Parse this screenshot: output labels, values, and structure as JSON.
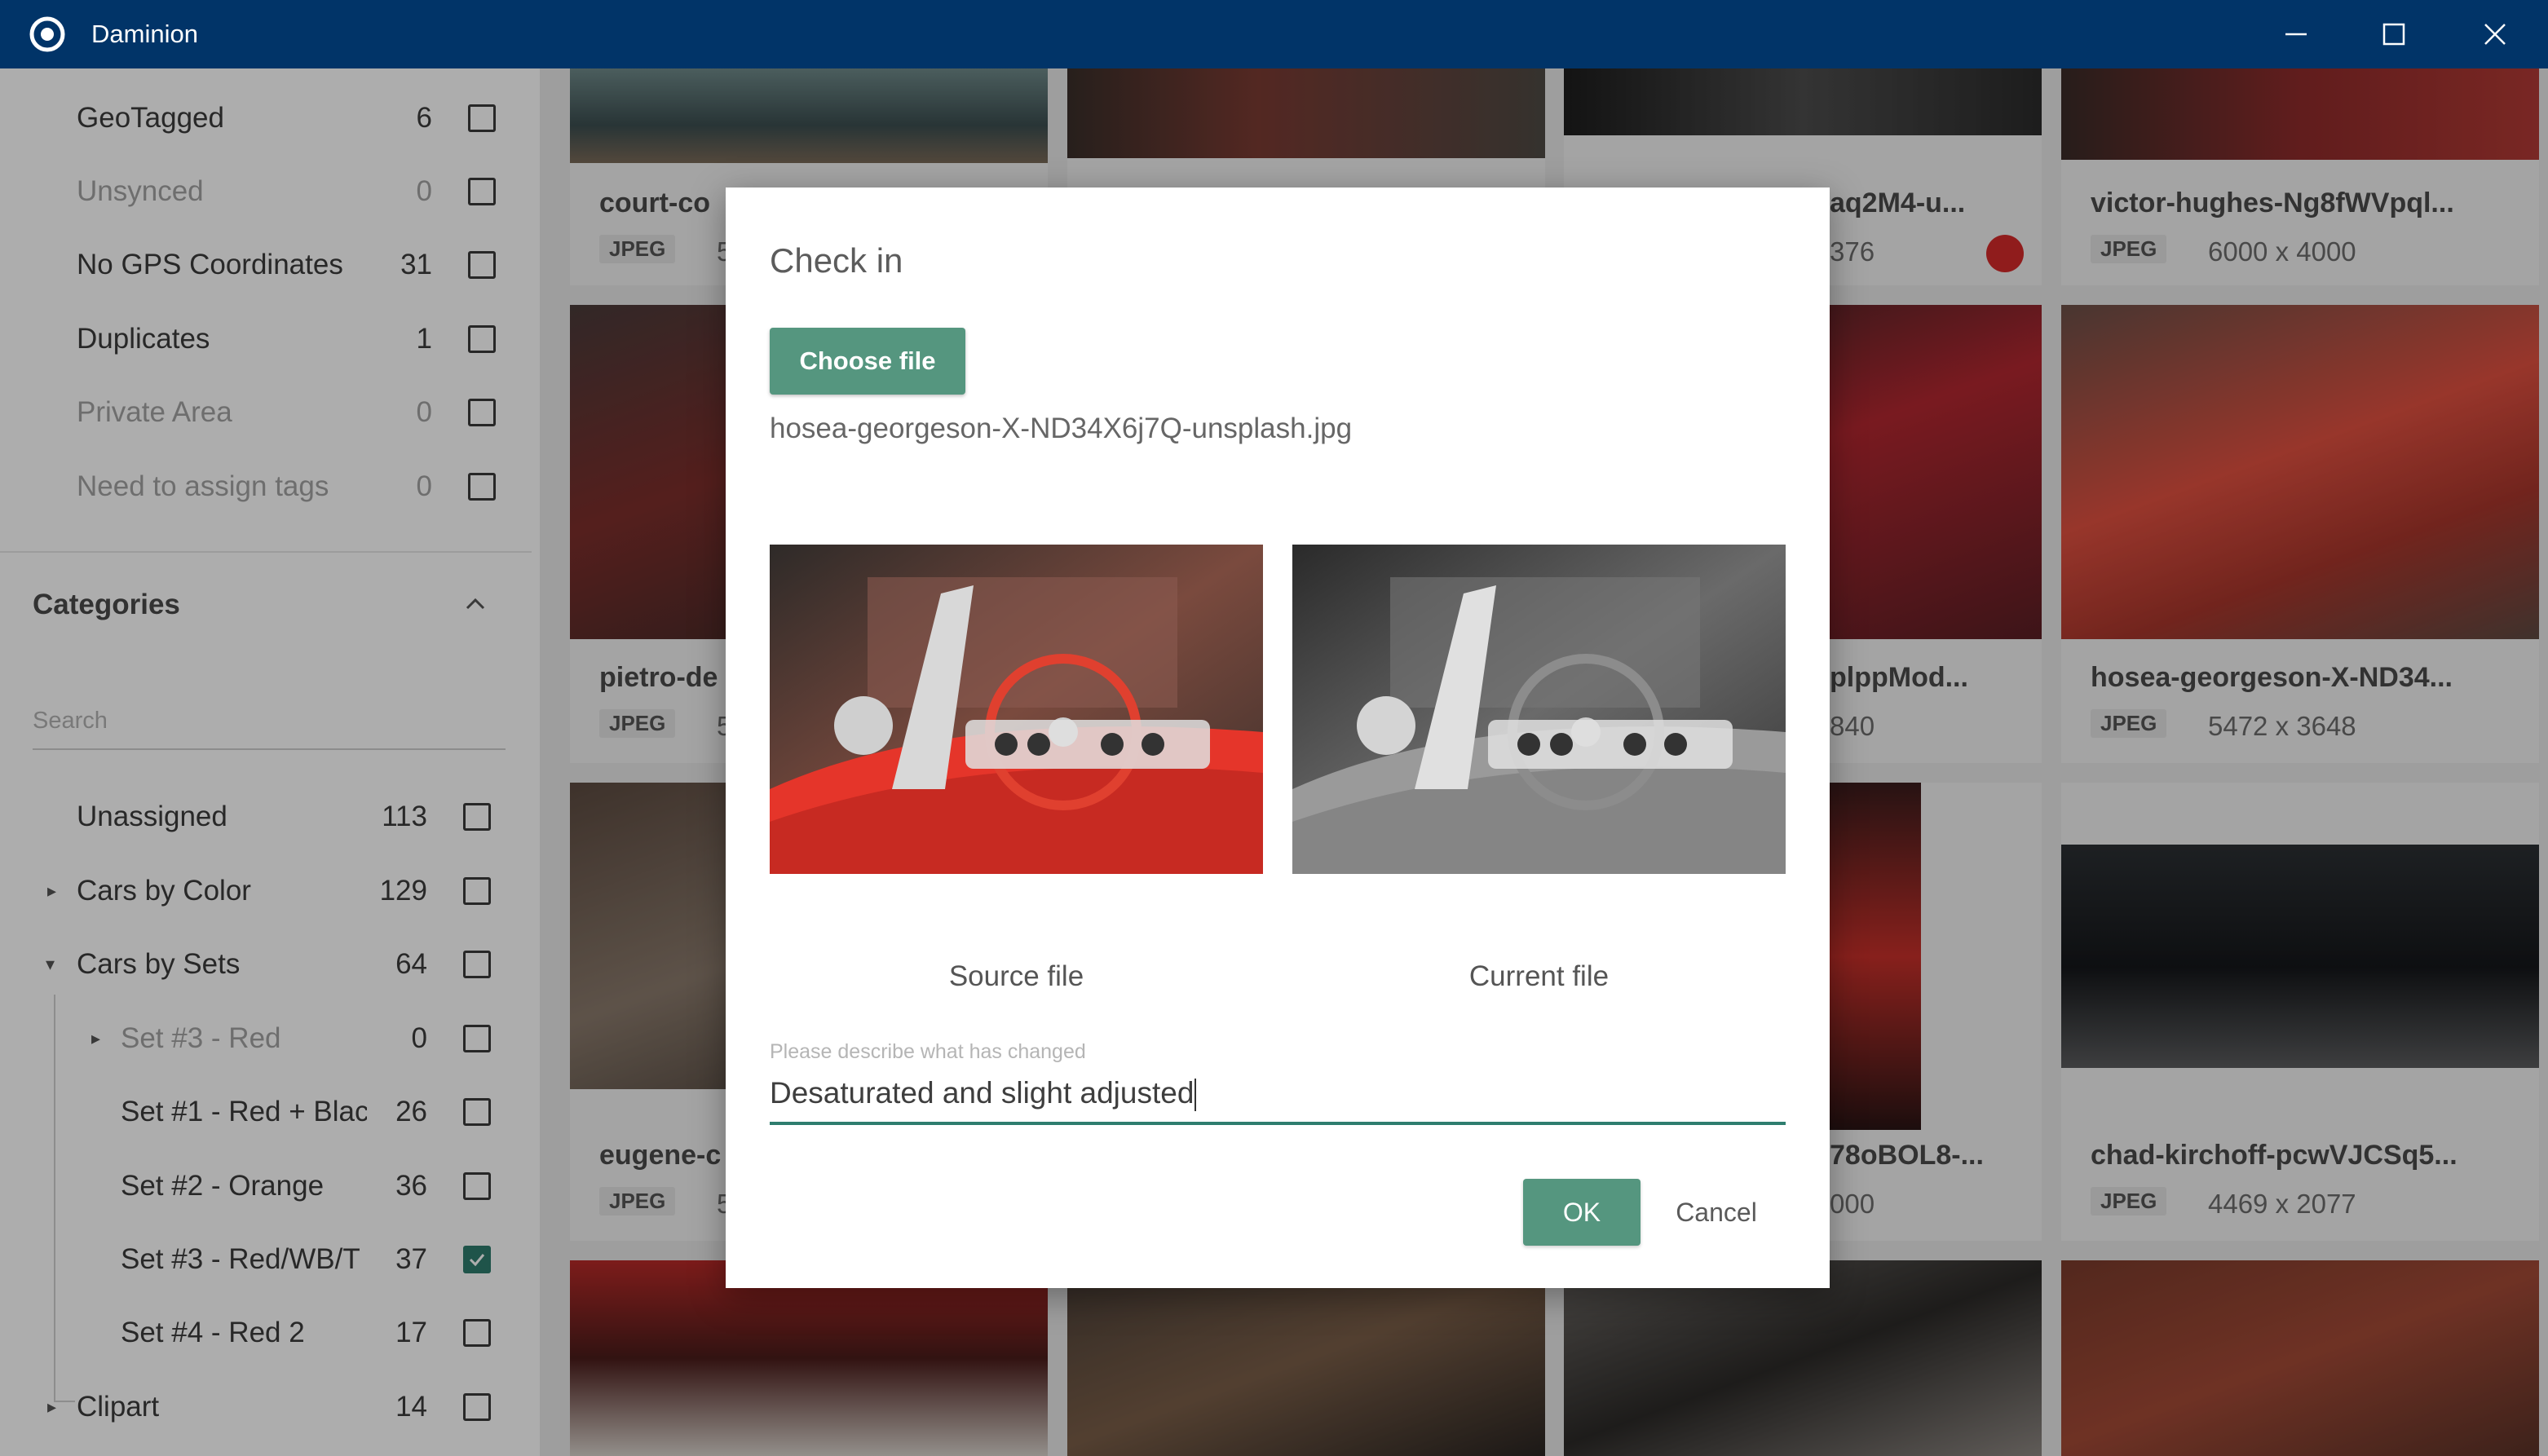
{
  "window": {
    "title": "Daminion"
  },
  "filters": [
    {
      "label": "GeoTagged",
      "count": "6",
      "dim": false
    },
    {
      "label": "Unsynced",
      "count": "0",
      "dim": true
    },
    {
      "label": "No GPS Coordinates",
      "count": "31",
      "dim": false
    },
    {
      "label": "Duplicates",
      "count": "1",
      "dim": false
    },
    {
      "label": "Private Area",
      "count": "0",
      "dim": true
    },
    {
      "label": "Need to assign tags",
      "count": "0",
      "dim": true
    }
  ],
  "categories": {
    "title": "Categories",
    "search_placeholder": "Search",
    "items": [
      {
        "label": "Unassigned",
        "count": "113",
        "checked": false
      },
      {
        "label": "Cars by Color",
        "count": "129",
        "checked": false
      },
      {
        "label": "Cars by Sets",
        "count": "64",
        "checked": false
      },
      {
        "label": "Set #3 - Red",
        "count": "0",
        "checked": false
      },
      {
        "label": "Set #1 - Red + Black",
        "count": "26",
        "checked": false
      },
      {
        "label": "Set #2 - Orange",
        "count": "36",
        "checked": false
      },
      {
        "label": "Set #3 - Red/WB/T",
        "count": "37",
        "checked": true
      },
      {
        "label": "Set #4 - Red 2",
        "count": "17",
        "checked": false
      },
      {
        "label": "Clipart",
        "count": "14",
        "checked": false
      }
    ]
  },
  "grid": {
    "tiles": [
      {
        "name": "court-co",
        "badge": "JPEG",
        "dims": "5"
      },
      {
        "name": "",
        "badge": "",
        "dims": ""
      },
      {
        "name": "aq2M4-u...",
        "badge": "",
        "dims": "376"
      },
      {
        "name": "victor-hughes-Ng8fWVpql...",
        "badge": "JPEG",
        "dims": "6000 x 4000"
      },
      {
        "name": "pietro-de",
        "badge": "JPEG",
        "dims": "5"
      },
      {
        "name": "",
        "badge": "",
        "dims": ""
      },
      {
        "name": "plppMod...",
        "badge": "",
        "dims": "840"
      },
      {
        "name": "hosea-georgeson-X-ND34...",
        "badge": "JPEG",
        "dims": "5472 x 3648"
      },
      {
        "name": "eugene-c",
        "badge": "JPEG",
        "dims": "5"
      },
      {
        "name": "",
        "badge": "",
        "dims": ""
      },
      {
        "name": "78oBOL8-...",
        "badge": "",
        "dims": "000"
      },
      {
        "name": "chad-kirchoff-pcwVJCSq5...",
        "badge": "JPEG",
        "dims": "4469 x 2077"
      }
    ]
  },
  "dialog": {
    "title": "Check in",
    "choose_label": "Choose file",
    "file_name": "hosea-georgeson-X-ND34X6j7Q-unsplash.jpg",
    "source_caption": "Source file",
    "current_caption": "Current file",
    "field_label": "Please describe what has changed",
    "field_value": "Desaturated and slight adjusted",
    "ok_label": "OK",
    "cancel_label": "Cancel"
  },
  "colors": {
    "titlebar": "#013468",
    "accent": "#55967f",
    "checkbox_checked": "#2e7d6e"
  }
}
